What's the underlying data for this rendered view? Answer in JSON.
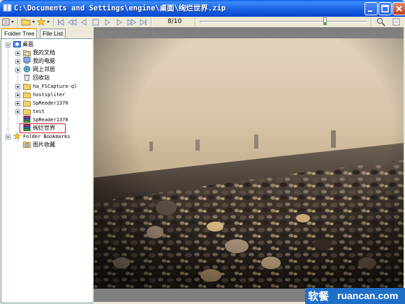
{
  "window": {
    "title": "C:\\Documents and Settings\\engine\\桌面\\绚烂世界.zip",
    "colors": {
      "titlebar": "#0A5FE6",
      "chrome": "#ECE9D8",
      "close": "#C4391B",
      "selection_border": "#E02020"
    }
  },
  "toolbar": {
    "page_counter": "8/10",
    "zoom_level": 0.75,
    "icons": [
      "view-menu-icon",
      "open-folder-icon",
      "favorites-icon",
      "first-page-icon",
      "previous-folder-icon",
      "previous-page-icon",
      "play-icon",
      "next-page-icon",
      "next-folder-icon",
      "last-page-icon",
      "zoom-icon",
      "fit-icon"
    ]
  },
  "tabs": [
    {
      "label": "Folder Tree",
      "active": true
    },
    {
      "label": "File List",
      "active": false
    }
  ],
  "tree": {
    "root": "桌面",
    "items": [
      {
        "label": "我的文档",
        "icon": "documents-icon",
        "expandable": true
      },
      {
        "label": "我的电脑",
        "icon": "computer-icon",
        "expandable": true
      },
      {
        "label": "网上邻居",
        "icon": "network-icon",
        "expandable": true
      },
      {
        "label": "回收站",
        "icon": "recycle-bin-icon",
        "expandable": false
      },
      {
        "label": "ha_FSCapture-ql",
        "icon": "folder-icon",
        "expandable": true
      },
      {
        "label": "hostspliter",
        "icon": "folder-icon",
        "expandable": true
      },
      {
        "label": "SpReader1370",
        "icon": "folder-icon",
        "expandable": true
      },
      {
        "label": "test",
        "icon": "folder-icon",
        "expandable": true
      },
      {
        "label": "SpReader1370",
        "icon": "archive-icon",
        "expandable": false
      },
      {
        "label": "绚烂世界",
        "icon": "archive-icon",
        "expandable": false,
        "selected": true
      }
    ],
    "bookmarks": {
      "label": "Folder Bookmarks",
      "items": [
        {
          "label": "图片收藏",
          "icon": "bookmark-folder-icon"
        }
      ]
    }
  },
  "watermark": {
    "cn": "软餐",
    "url": "ruancan.com"
  }
}
